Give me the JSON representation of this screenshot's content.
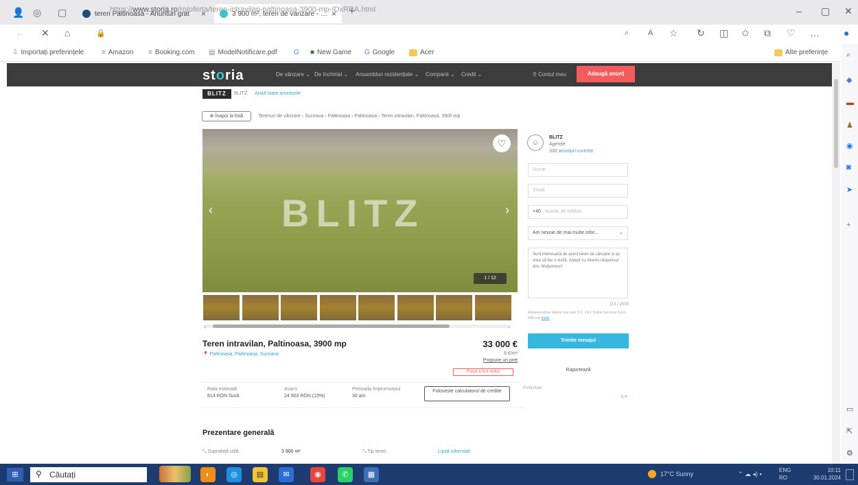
{
  "browser": {
    "tabs": [
      {
        "label": "teren Paltinoasa - Anunturi grat",
        "close": "×"
      },
      {
        "label": "3 900 m², teren de vanzare - Suc",
        "close": "×"
      }
    ],
    "new_tab": "+",
    "url_prefix": "https://",
    "url_domain": "www.storia.ro",
    "url_path": "/ro/oferta/teren-intravilan-paltinoasa-3900-mp-IDxRRA.html",
    "bookmarks": [
      "Importați preferințele",
      "Amazon",
      "Booking.com",
      "ModelNotificare.pdf",
      "",
      "New Game",
      "Google",
      "Acer"
    ],
    "other_bookmarks": "Alte preferințe",
    "window_controls": {
      "minimize": "–",
      "restore": "▢",
      "close": "✕"
    }
  },
  "site": {
    "logo_pre": "st",
    "logo_mid": "o",
    "logo_post": "ria",
    "nav": [
      "De vânzare ⌄",
      "De închiriat ⌄",
      "Ansambluri rezidențiale ⌄",
      "Companii ⌄",
      "Credit ⌄"
    ],
    "account": "Contul meu",
    "add_button": "Adaugă anunț"
  },
  "agency": {
    "badge": "BLITZ",
    "name": "BLITZ",
    "link": "Arată toate anunțurile"
  },
  "back_button": "Înapoi la listă",
  "breadcrumbs": "Terenuri de vânzare › Suceava › Paltinoasa › Paltinoasa › Teren intravilan, Paltinoasa, 3900 mp",
  "gallery": {
    "watermark": "BLITZ",
    "counter": "1 / 12",
    "thumb_count": 8
  },
  "listing": {
    "title": "Teren intravilan, Paltinoasa, 3900 mp",
    "location": "Paltinoasa, Paltinoasa, Suceava",
    "price": "33 000 €",
    "price_per_m2": "8 €/m²",
    "offer_link": "Propune un preț",
    "tag": "Prețul a fost redus"
  },
  "finance": {
    "rate_label": "Rata estimată",
    "rate_value": "814 RON /lună",
    "advance_label": "Avans",
    "advance_value": "24 503 RON (15%)",
    "period_label": "Perioada împrumutului",
    "period_value": "30 ani",
    "calc_button": "Folosește calculatorul de credite",
    "ad_label": "Publicitate"
  },
  "overview": {
    "heading": "Prezentare generală",
    "area_label": "Suprafață utilă",
    "area_value": "3 900 m²",
    "type_label": "Tip teren",
    "type_value": "Lipsă informații"
  },
  "contact": {
    "agent_name": "BLITZ",
    "agent_type": "Agenție",
    "agent_count": "330",
    "agent_link": "anunțuri curente",
    "name_placeholder": "Nume",
    "email_placeholder": "Email",
    "phone_prefix": "+40",
    "phone_placeholder": "Număr de telefon",
    "interest_select": "Am nevoie de mai multe infor...",
    "message": "Sunt interesat/ă de acest teren de vânzare și aș vrea să fac o vizită. Aștept cu interes răspunsul dvs. Mulțumesc!",
    "char_count": "113 / 2000",
    "admin_text": "Administratorul datelor tale este S.C. OLX Online Services S.R.L. Află mai",
    "admin_link": "multe",
    "send_button": "Trimite mesajul",
    "report": "Raportează"
  },
  "taskbar": {
    "start": "⊞",
    "search_placeholder": "Căutați",
    "weather": "17°C Sunny",
    "lang": "ENG",
    "lang2": "RO",
    "time": "10:11",
    "date": "30.01.2024"
  }
}
